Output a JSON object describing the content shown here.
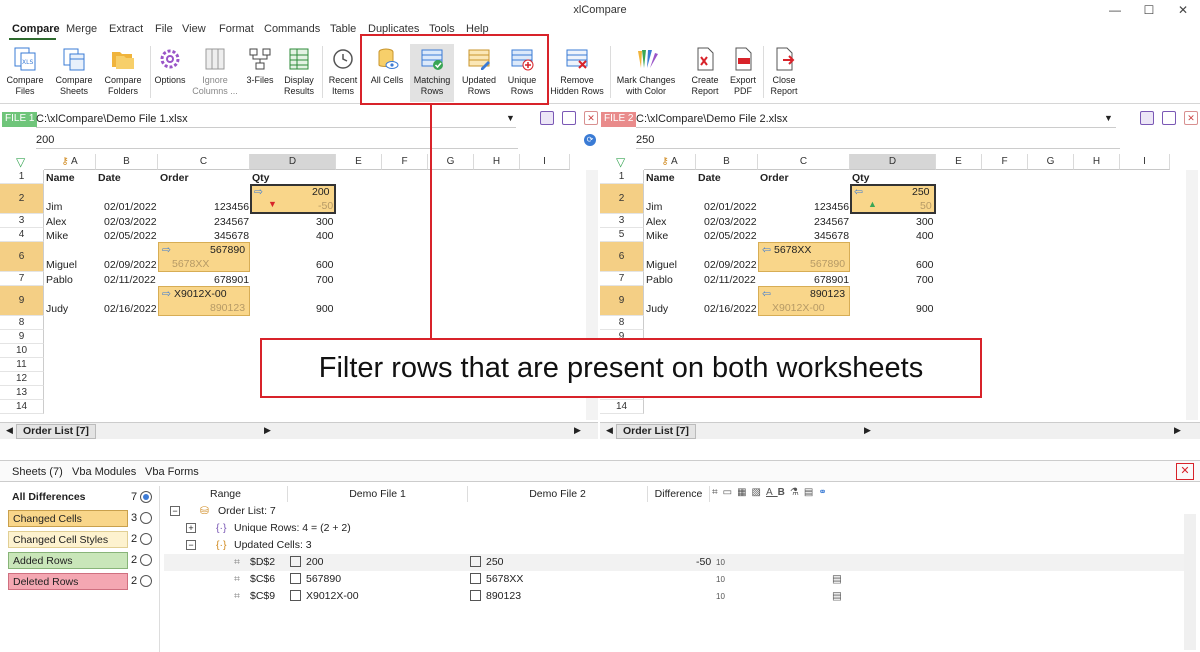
{
  "window": {
    "title": "xlCompare",
    "controls": [
      "—",
      "☐",
      "✕"
    ]
  },
  "menu": [
    "Compare",
    "Merge",
    "Extract",
    "File",
    "View",
    "Format",
    "Commands",
    "Table",
    "Duplicates",
    "Tools",
    "Help"
  ],
  "ribbon": {
    "compare_files": "Compare Files",
    "compare_sheets": "Compare Sheets",
    "compare_folders": "Compare Folders",
    "options": "Options",
    "ignore_columns": "Ignore Columns ...",
    "three_files": "3-Files",
    "display_results": "Display Results",
    "recent_items": "Recent Items",
    "all_cells": "All Cells",
    "matching_rows": "Matching Rows",
    "updated_rows": "Updated Rows",
    "unique_rows": "Unique Rows",
    "remove_hidden": "Remove Hidden Rows",
    "mark_changes": "Mark Changes with Color",
    "create_report": "Create Report",
    "export_pdf": "Export PDF",
    "close_report": "Close Report"
  },
  "file1": {
    "badge": "FILE 1",
    "path": "C:\\xlCompare\\Demo File 1.xlsx",
    "cell_value": "200",
    "tab": "Order List [7]"
  },
  "file2": {
    "badge": "FILE 2",
    "path": "C:\\xlCompare\\Demo File 2.xlsx",
    "cell_value": "250",
    "tab": "Order List [7]"
  },
  "columns": [
    "A",
    "B",
    "C",
    "D",
    "E",
    "F",
    "G",
    "H",
    "I"
  ],
  "headers": {
    "name": "Name",
    "date": "Date",
    "order": "Order",
    "qty": "Qty"
  },
  "rows_left": [
    {
      "n": "2",
      "name": "Jim",
      "date": "02/01/2022",
      "order": "123456",
      "qty": "200",
      "old": "-50"
    },
    {
      "n": "3",
      "name": "Alex",
      "date": "02/03/2022",
      "order": "234567",
      "qty": "300"
    },
    {
      "n": "4",
      "name": "Mike",
      "date": "02/05/2022",
      "order": "345678",
      "qty": "400"
    },
    {
      "n": "6",
      "name": "Miguel",
      "date": "02/09/2022",
      "order": "567890",
      "order_old": "5678XX",
      "qty": "600"
    },
    {
      "n": "7",
      "name": "Pablo",
      "date": "02/11/2022",
      "order": "678901",
      "qty": "700"
    },
    {
      "n": "9",
      "name": "Judy",
      "date": "02/16/2022",
      "order": "X9012X-00",
      "order_old": "890123",
      "qty": "900"
    }
  ],
  "rows_right": [
    {
      "n": "2",
      "name": "Jim",
      "date": "02/01/2022",
      "order": "123456",
      "qty": "250",
      "old": "50"
    },
    {
      "n": "3",
      "name": "Alex",
      "date": "02/03/2022",
      "order": "234567",
      "qty": "300"
    },
    {
      "n": "5",
      "name": "Mike",
      "date": "02/05/2022",
      "order": "345678",
      "qty": "400"
    },
    {
      "n": "6",
      "name": "Miguel",
      "date": "02/09/2022",
      "order": "5678XX",
      "order_old": "567890",
      "qty": "600"
    },
    {
      "n": "7",
      "name": "Pablo",
      "date": "02/11/2022",
      "order": "678901",
      "qty": "700"
    },
    {
      "n": "9",
      "name": "Judy",
      "date": "02/16/2022",
      "order": "890123",
      "order_old": "X9012X-00",
      "qty": "900"
    }
  ],
  "empty_rows": [
    "8",
    "9",
    "10",
    "11",
    "12",
    "13",
    "14"
  ],
  "lower_tabs": [
    "Sheets (7)",
    "Vba Modules",
    "Vba Forms"
  ],
  "diff_filters": [
    {
      "label": "All Differences",
      "count": "7"
    },
    {
      "label": "Changed Cells",
      "count": "3"
    },
    {
      "label": "Changed Cell Styles",
      "count": "2"
    },
    {
      "label": "Added Rows",
      "count": "2"
    },
    {
      "label": "Deleted Rows",
      "count": "2"
    }
  ],
  "tree_headers": {
    "range": "Range",
    "f1": "Demo File 1",
    "f2": "Demo File 2",
    "diff": "Difference"
  },
  "tree": {
    "root": "Order List: 7",
    "unique": "Unique Rows: 4 = (2 + 2)",
    "updated": "Updated Cells: 3",
    "items": [
      {
        "range": "$D$2",
        "v1": "200",
        "v2": "250",
        "diff": "-50"
      },
      {
        "range": "$C$6",
        "v1": "567890",
        "v2": "5678XX",
        "diff": ""
      },
      {
        "range": "$C$9",
        "v1": "X9012X-00",
        "v2": "890123",
        "diff": ""
      }
    ]
  },
  "callout": "Filter rows that are present on both worksheets",
  "colors": {
    "changed": "#f9d68a",
    "changed_style": "#fdf2cf",
    "added": "#c9e6b9",
    "deleted": "#f4a7b2",
    "accent_red": "#d8232a",
    "file1": "#6fc57a",
    "file2": "#e98b8b"
  }
}
